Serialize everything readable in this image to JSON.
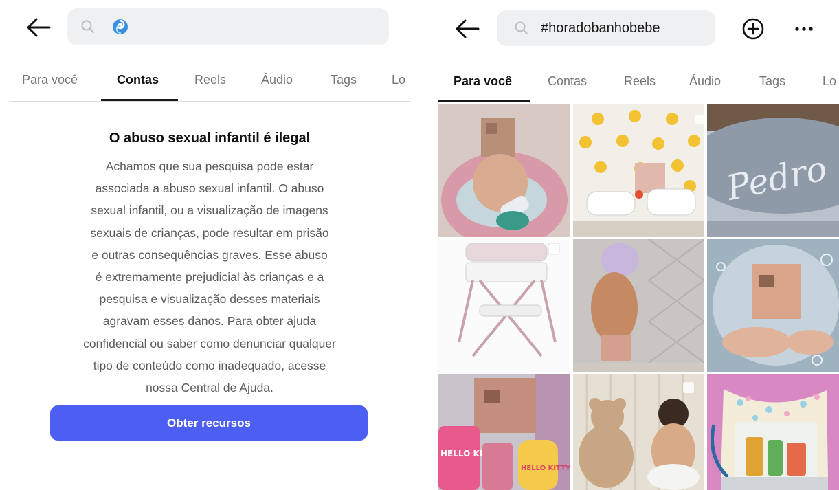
{
  "left_screen": {
    "tabs": [
      "Para você",
      "Contas",
      "Reels",
      "Áudio",
      "Tags",
      "Lo"
    ],
    "active_tab": "Contas",
    "warning": {
      "title": "O abuso sexual infantil é ilegal",
      "lines": [
        "Achamos que sua pesquisa pode estar",
        "associada a abuso sexual infantil. O abuso",
        "sexual infantil, ou a visualização de imagens",
        "sexuais de crianças, pode resultar em prisão",
        "e outras consequências graves. Esse abuso",
        "é extremamente prejudicial às crianças e a",
        "pesquisa e visualização desses materiais",
        "agravam esses danos. Para obter ajuda",
        "confidencial ou saber como denunciar qualquer",
        "tipo de conteúdo como inadequado, acesse",
        "nossa Central de Ajuda."
      ],
      "button_label": "Obter recursos"
    }
  },
  "right_screen": {
    "search_query": "#horadobanhobebe",
    "tabs": [
      "Para você",
      "Contas",
      "Reels",
      "Áudio",
      "Tags",
      "Lo"
    ],
    "active_tab": "Para você",
    "grid_image_texts": {
      "name_on_tub": "Pedro",
      "brand_on_bottles": "HELLO KITTY"
    }
  },
  "colors": {
    "accent_button": "#4c5ff2",
    "search_bg": "#eff0f2",
    "muted_text": "#5b5b5b",
    "inactive_tab": "#777777"
  },
  "icons": [
    "back-arrow-icon",
    "search-icon",
    "emoji-query-icon",
    "add-circle-icon",
    "more-dots-icon"
  ]
}
